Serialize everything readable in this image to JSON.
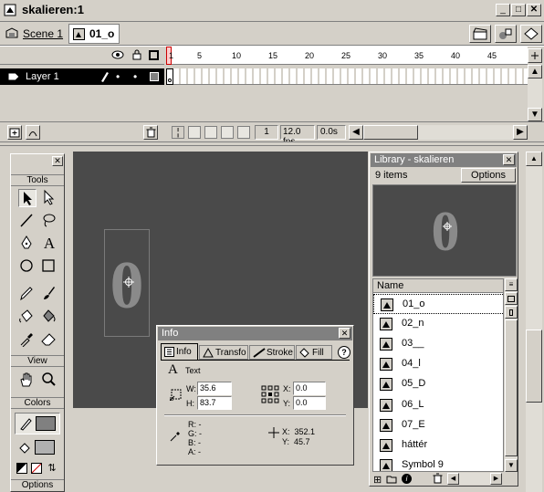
{
  "window": {
    "title": "skalieren:1",
    "minimize": "_",
    "maximize": "□",
    "close": "✕"
  },
  "nav": {
    "scene": "Scene 1",
    "symbol": "01_o"
  },
  "timeline": {
    "frame_numbers": [
      "1",
      "5",
      "10",
      "15",
      "20",
      "25",
      "30",
      "35",
      "40",
      "45"
    ],
    "layer": {
      "name": "Layer 1",
      "dot1": "•",
      "dot2": "•"
    },
    "status": {
      "frame": "1",
      "fps": "12.0 fps",
      "time": "0.0s"
    }
  },
  "tools": {
    "title": "Tools",
    "view": "View",
    "colors": "Colors",
    "options": "Options",
    "text_tool": "A"
  },
  "canvas": {
    "glyph": "0"
  },
  "info": {
    "title": "Info",
    "tabs": [
      "Info",
      "Transfo",
      "Stroke",
      "Fill"
    ],
    "help": "?",
    "object_type": "Text",
    "w_label": "W:",
    "w": "35.6",
    "h_label": "H:",
    "h": "83.7",
    "x_label": "X:",
    "x": "0.0",
    "y_label": "Y:",
    "y": "0.0",
    "r": "R: -",
    "g": "G: -",
    "b": "B: -",
    "a": "A: -",
    "cursor_x": "X:  352.1",
    "cursor_y": "Y:  45.7"
  },
  "library": {
    "title": "Library - skalieren",
    "count": "9 items",
    "options": "Options",
    "preview_glyph": "0",
    "column": "Name",
    "items": [
      "01_o",
      "02_n",
      "03__",
      "04_l",
      "05_D",
      "06_L",
      "07_E",
      "háttér",
      "Symbol 9"
    ]
  },
  "colors": {
    "stage": "#4a4a4a",
    "glyph": "#8a8a8a",
    "chrome": "#d4d0c8",
    "selection": "#000000"
  }
}
